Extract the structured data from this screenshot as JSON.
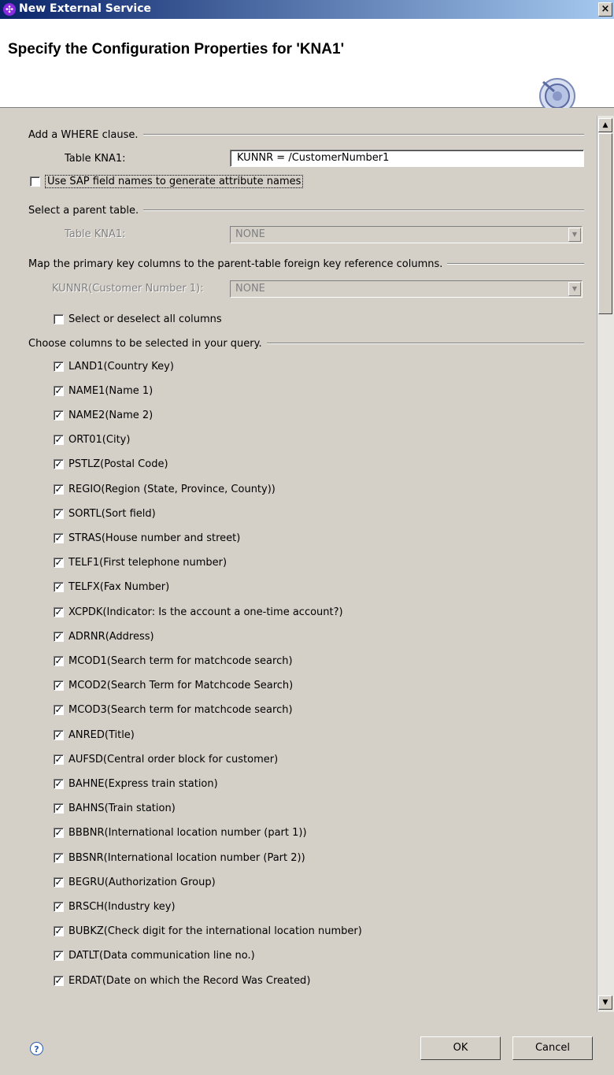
{
  "window": {
    "title": "New External Service",
    "close_glyph": "×"
  },
  "banner": {
    "heading": "Specify the Configuration Properties for 'KNA1'"
  },
  "where": {
    "section_label": "Add a WHERE clause.",
    "table_label": "Table KNA1:",
    "table_value": "KUNNR = /CustomerNumber1",
    "sap_names_label": "Use SAP field names to generate attribute names",
    "sap_names_checked": false
  },
  "parent": {
    "section_label": "Select a parent table.",
    "table_label": "Table KNA1:",
    "table_value": "NONE"
  },
  "map": {
    "section_label": "Map the primary key columns to the parent-table foreign key reference columns.",
    "key_label": "KUNNR(Customer Number 1):",
    "key_value": "NONE",
    "select_all_label": "Select or deselect all columns",
    "select_all_checked": false
  },
  "columns": {
    "section_label": "Choose columns to be selected in your query.",
    "items": [
      {
        "label": "LAND1(Country Key)",
        "checked": true
      },
      {
        "label": "NAME1(Name 1)",
        "checked": true
      },
      {
        "label": "NAME2(Name 2)",
        "checked": true
      },
      {
        "label": "ORT01(City)",
        "checked": true
      },
      {
        "label": "PSTLZ(Postal Code)",
        "checked": true
      },
      {
        "label": "REGIO(Region (State, Province, County))",
        "checked": true
      },
      {
        "label": "SORTL(Sort field)",
        "checked": true
      },
      {
        "label": "STRAS(House number and street)",
        "checked": true
      },
      {
        "label": "TELF1(First telephone number)",
        "checked": true
      },
      {
        "label": "TELFX(Fax Number)",
        "checked": true
      },
      {
        "label": "XCPDK(Indicator: Is the account a one-time account?)",
        "checked": true
      },
      {
        "label": "ADRNR(Address)",
        "checked": true
      },
      {
        "label": "MCOD1(Search term for matchcode search)",
        "checked": true
      },
      {
        "label": "MCOD2(Search Term for Matchcode Search)",
        "checked": true
      },
      {
        "label": "MCOD3(Search term for matchcode search)",
        "checked": true
      },
      {
        "label": "ANRED(Title)",
        "checked": true
      },
      {
        "label": "AUFSD(Central order block for customer)",
        "checked": true
      },
      {
        "label": "BAHNE(Express train station)",
        "checked": true
      },
      {
        "label": "BAHNS(Train station)",
        "checked": true
      },
      {
        "label": "BBBNR(International location number  (part 1))",
        "checked": true
      },
      {
        "label": "BBSNR(International location number (Part 2))",
        "checked": true
      },
      {
        "label": "BEGRU(Authorization Group)",
        "checked": true
      },
      {
        "label": "BRSCH(Industry key)",
        "checked": true
      },
      {
        "label": "BUBKZ(Check digit for the international location number)",
        "checked": true
      },
      {
        "label": "DATLT(Data communication line no.)",
        "checked": true
      },
      {
        "label": "ERDAT(Date on which the Record Was Created)",
        "checked": true
      }
    ]
  },
  "footer": {
    "help_glyph": "?",
    "ok_label": "OK",
    "cancel_label": "Cancel"
  },
  "icons": {
    "check_glyph": "✓",
    "scroll_up": "up-arrow-icon",
    "scroll_down": "down-arrow-icon",
    "combo_arrow": "chevron-down-icon"
  }
}
